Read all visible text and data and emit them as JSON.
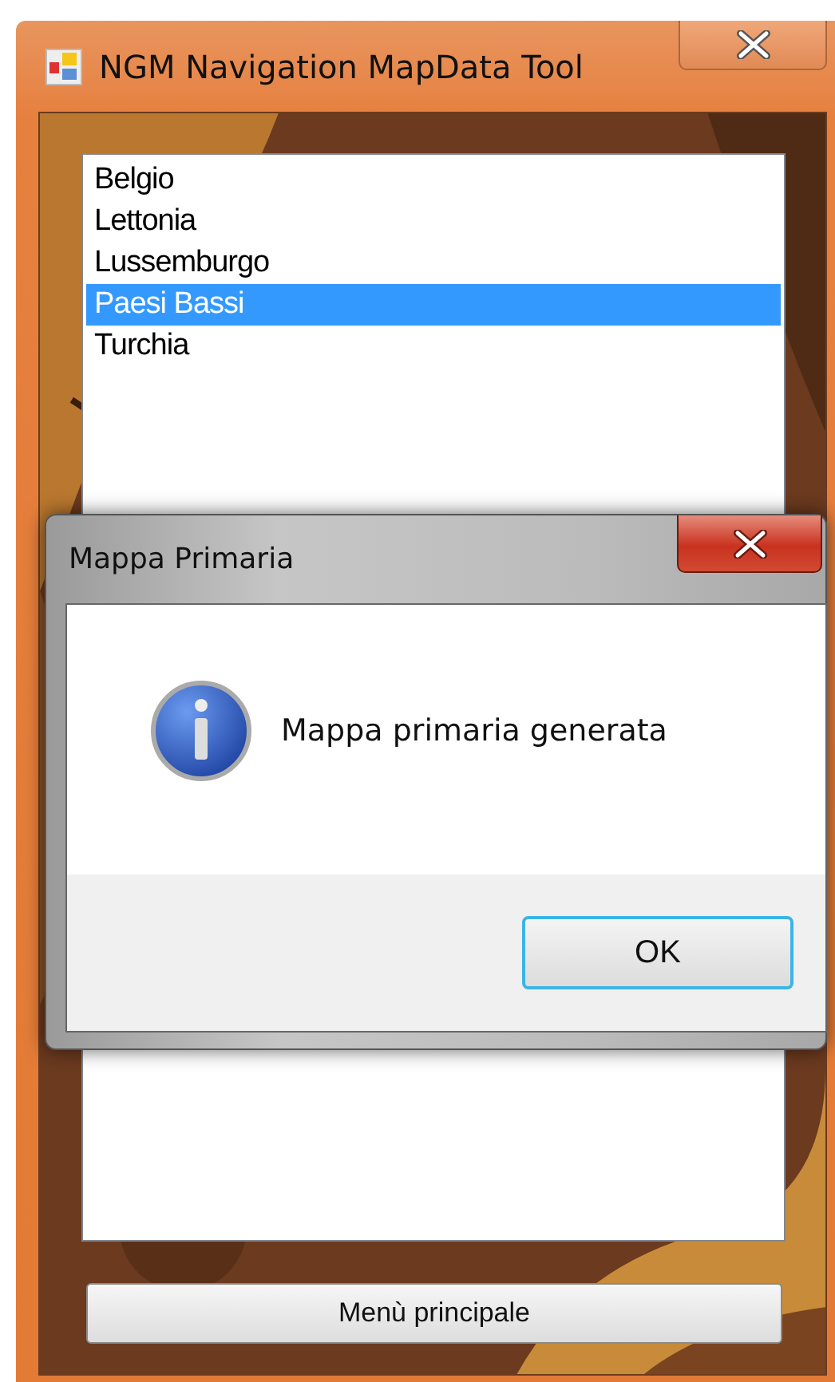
{
  "window": {
    "title": "NGM Navigation MapData Tool"
  },
  "list": {
    "items": [
      {
        "label": "Belgio",
        "selected": false
      },
      {
        "label": "Lettonia",
        "selected": false
      },
      {
        "label": "Lussemburgo",
        "selected": false
      },
      {
        "label": "Paesi Bassi",
        "selected": true
      },
      {
        "label": "Turchia",
        "selected": false
      }
    ]
  },
  "main_button": "Menù principale",
  "dialog": {
    "title": "Mappa Primaria",
    "message": "Mappa primaria generata",
    "button": "OK"
  }
}
